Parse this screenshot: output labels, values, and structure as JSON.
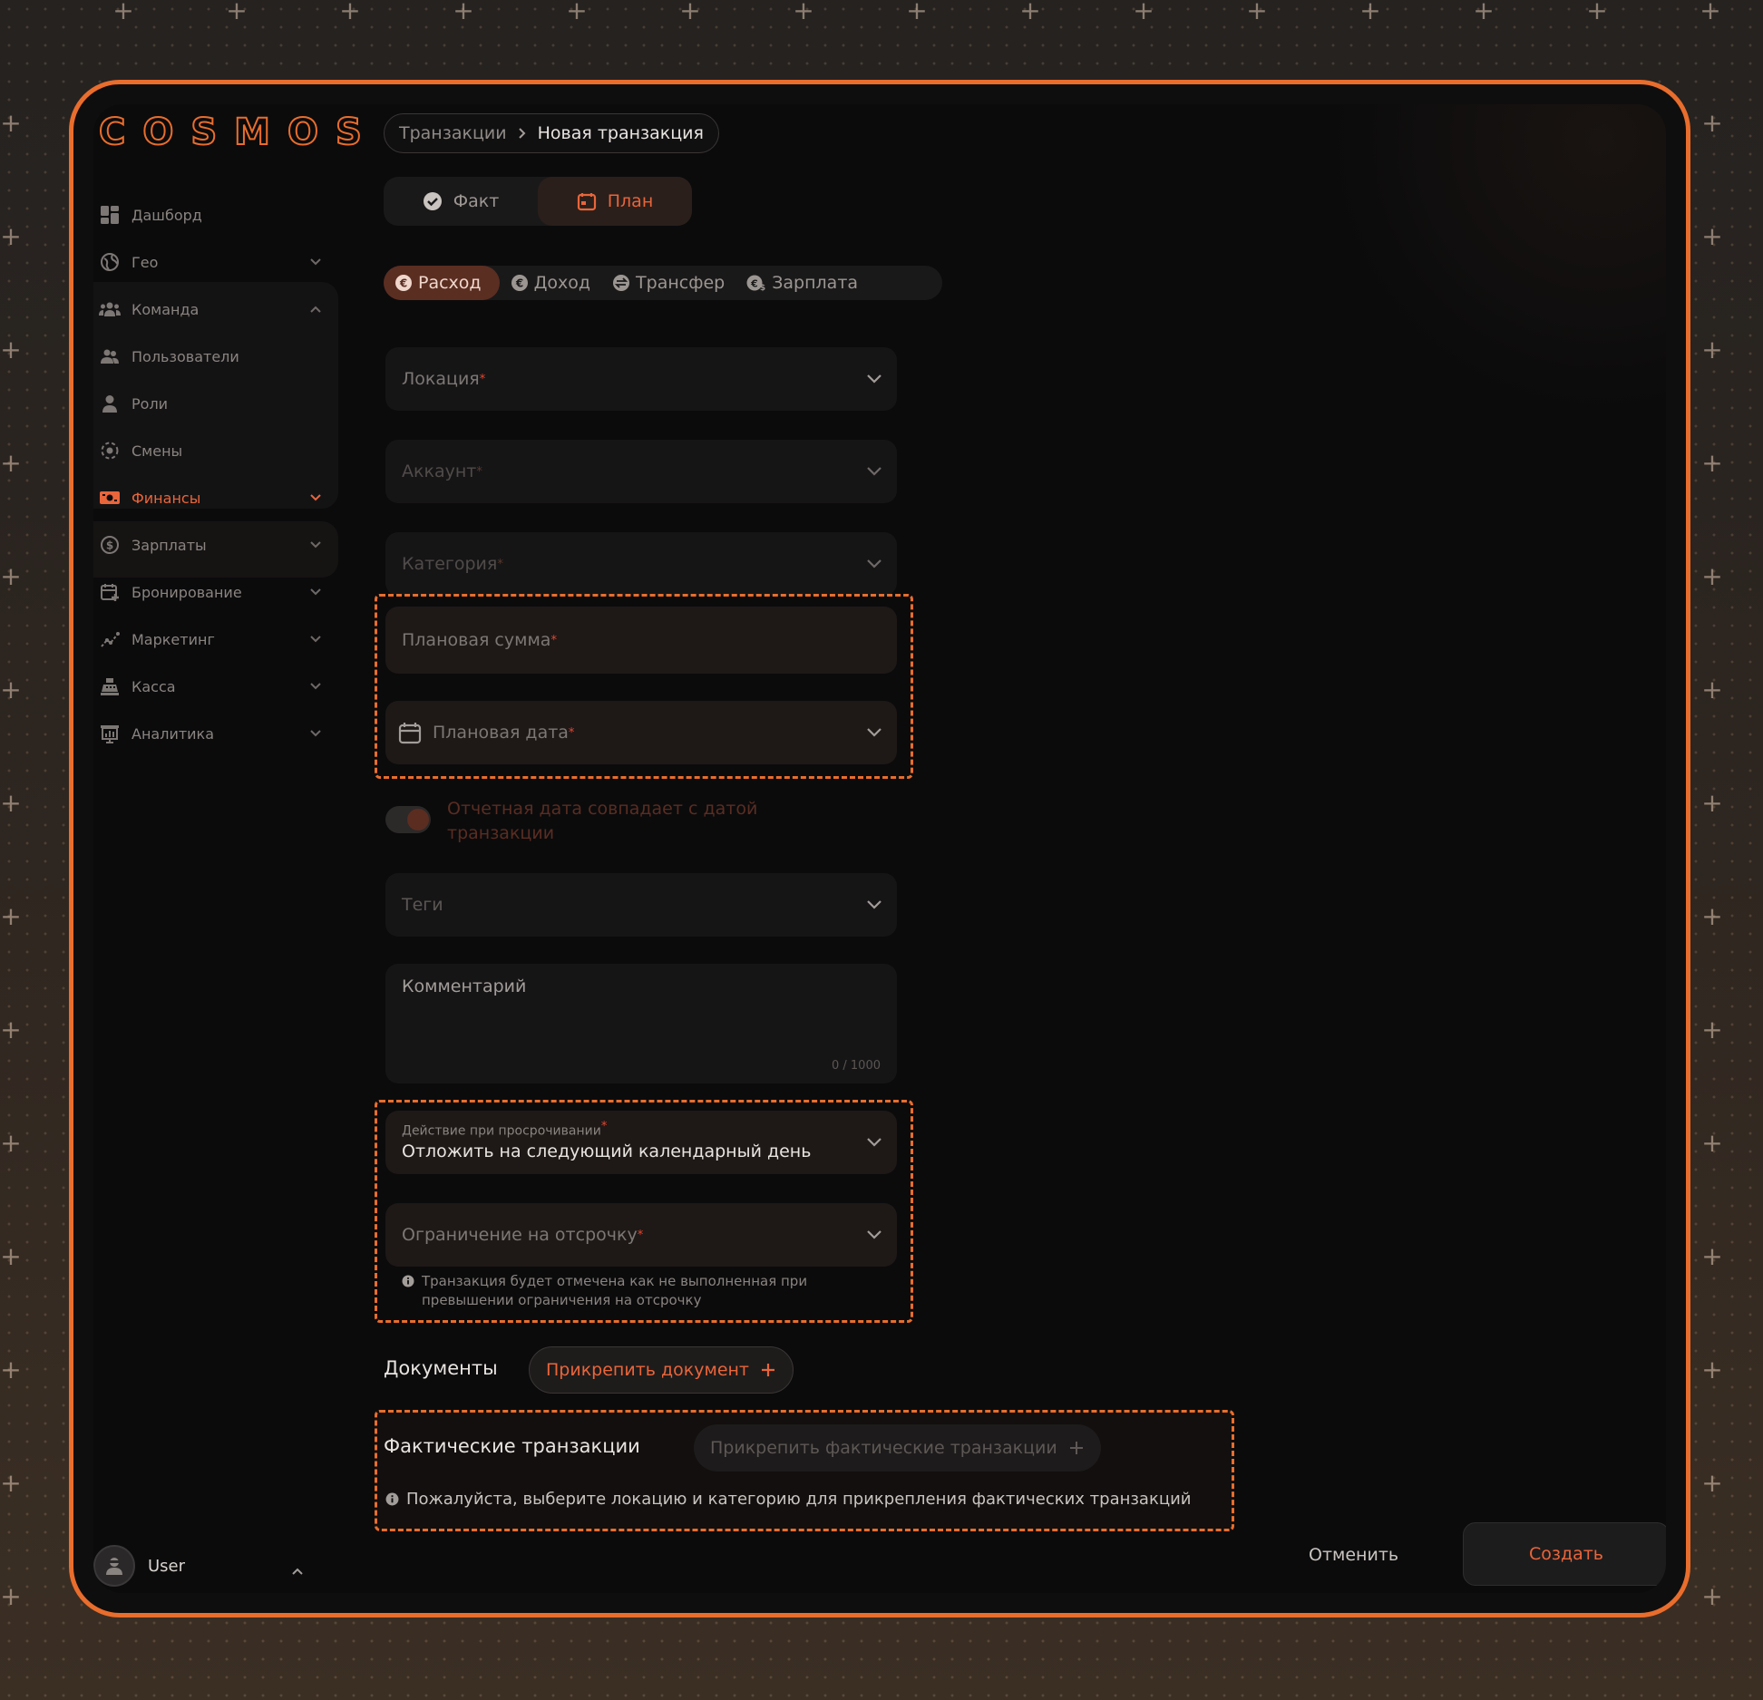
{
  "app": {
    "logo": "COSMOS"
  },
  "breadcrumb": {
    "parent": "Транзакции",
    "current": "Новая транзакция"
  },
  "mode_tabs": [
    {
      "label": "Факт",
      "active": false
    },
    {
      "label": "План",
      "active": true
    }
  ],
  "type_tabs": [
    {
      "label": "Расход",
      "active": true
    },
    {
      "label": "Доход",
      "active": false
    },
    {
      "label": "Трансфер",
      "active": false
    },
    {
      "label": "Зарплата",
      "active": false
    }
  ],
  "sidebar": {
    "items": [
      {
        "label": "Дашборд",
        "icon": "dashboard-icon"
      },
      {
        "label": "Гео",
        "icon": "globe-icon",
        "expandable": true
      },
      {
        "label": "Команда",
        "icon": "team-icon",
        "expanded": true
      },
      {
        "label": "Пользователи",
        "icon": "users-icon"
      },
      {
        "label": "Роли",
        "icon": "person-icon"
      },
      {
        "label": "Смены",
        "icon": "shift-icon"
      },
      {
        "label": "Финансы",
        "icon": "money-icon",
        "active": true,
        "expandable": true
      },
      {
        "label": "Зарплаты",
        "icon": "dollar-icon",
        "expandable": true
      },
      {
        "label": "Бронирование",
        "icon": "calendar-plus-icon",
        "expandable": true
      },
      {
        "label": "Маркетинг",
        "icon": "chart-line-icon",
        "expandable": true
      },
      {
        "label": "Касса",
        "icon": "cash-register-icon",
        "expandable": true
      },
      {
        "label": "Аналитика",
        "icon": "analytics-icon",
        "expandable": true
      }
    ],
    "user": {
      "name": "User"
    }
  },
  "form": {
    "location": {
      "placeholder": "Локация"
    },
    "account": {
      "placeholder": "Аккаунт"
    },
    "category": {
      "placeholder": "Категория"
    },
    "planned_amount": {
      "placeholder": "Плановая сумма"
    },
    "planned_date": {
      "placeholder": "Плановая дата"
    },
    "report_date_toggle": {
      "label": "Отчетная дата совпадает с датой транзакции",
      "on": true
    },
    "tags": {
      "placeholder": "Теги"
    },
    "comment": {
      "placeholder": "Комментарий",
      "counter": "0 / 1000"
    },
    "overdue_action": {
      "label": "Действие при просрочивании",
      "value": "Отложить на следующий календарный день"
    },
    "delay_limit": {
      "placeholder": "Ограничение на отсрочку",
      "hint": "Транзакция будет отмечена как не выполненная при превышении ограничения на отсрочку"
    }
  },
  "documents": {
    "title": "Документы",
    "attach_label": "Прикрепить документ"
  },
  "actual_transactions": {
    "title": "Фактические транзакции",
    "attach_label": "Прикрепить фактические транзакции",
    "hint": "Пожалуйста, выберите локацию и категорию для прикрепления фактических транзакций"
  },
  "footer": {
    "cancel_label": "Отменить",
    "create_label": "Создать"
  },
  "colors": {
    "accent": "#e96d2c",
    "accent_text": "#e9653a",
    "background": "#0b0b0c",
    "field": "#161516"
  }
}
